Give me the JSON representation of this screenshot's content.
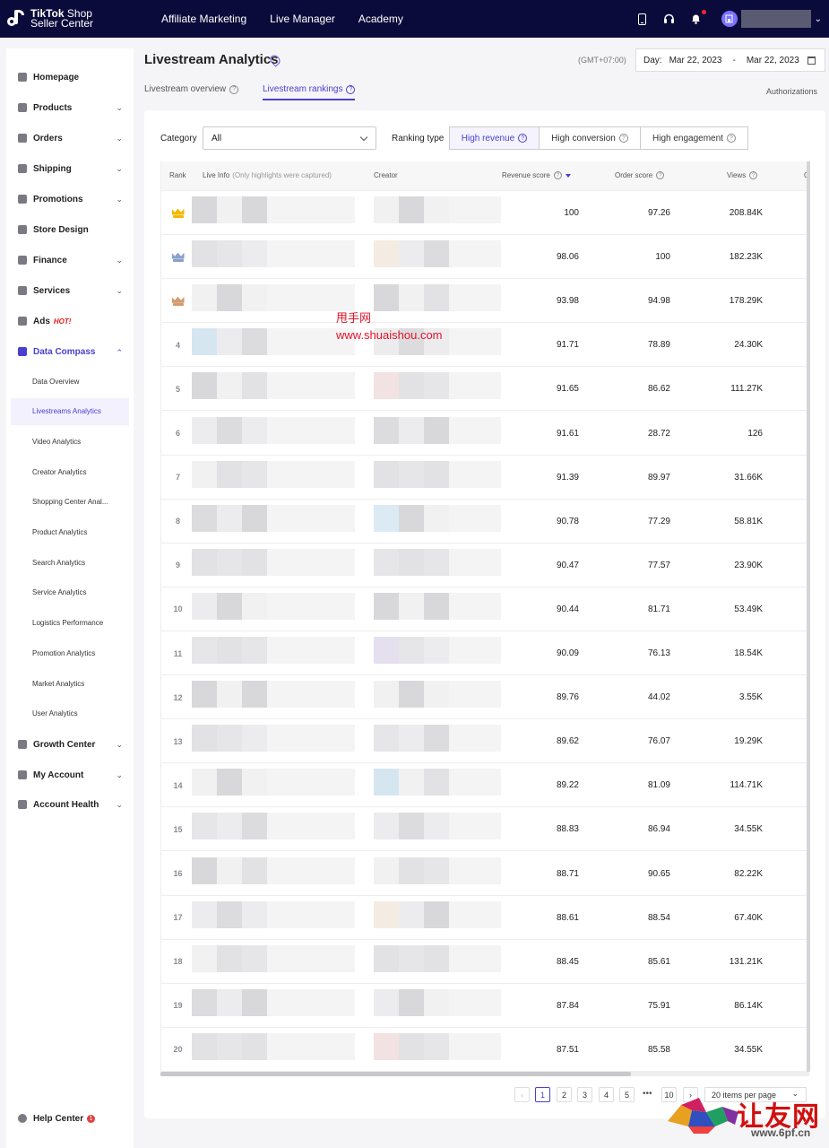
{
  "topbar": {
    "logo_line1": "TikTok",
    "logo_line1b": " Shop",
    "logo_line2": "Seller Center",
    "nav": [
      "Affiliate Marketing",
      "Live Manager",
      "Academy"
    ],
    "avatar_letter": "D"
  },
  "sidebar": {
    "items": [
      {
        "label": "Homepage",
        "icon": "home-icon",
        "caret": false
      },
      {
        "label": "Products",
        "icon": "box-icon",
        "caret": true
      },
      {
        "label": "Orders",
        "icon": "orders-icon",
        "caret": true
      },
      {
        "label": "Shipping",
        "icon": "truck-icon",
        "caret": true
      },
      {
        "label": "Promotions",
        "icon": "megaphone-icon",
        "caret": true
      },
      {
        "label": "Store Design",
        "icon": "store-icon",
        "caret": false
      },
      {
        "label": "Finance",
        "icon": "card-icon",
        "caret": true
      },
      {
        "label": "Services",
        "icon": "globe-icon",
        "caret": true
      },
      {
        "label": "Ads",
        "icon": "ads-icon",
        "caret": false,
        "badge": "HOT!"
      },
      {
        "label": "Data Compass",
        "icon": "chart-icon",
        "caret": true,
        "expanded": true
      }
    ],
    "sub_items": [
      "Data Overview",
      "Livestreams Analytics",
      "Video Analytics",
      "Creator Analytics",
      "Shopping Center Anal...",
      "Product Analytics",
      "Search Analytics",
      "Service Analytics",
      "Logistics Performance",
      "Promotion Analytics",
      "Market Analytics",
      "User Analytics"
    ],
    "active_sub": 1,
    "bottom_items": [
      {
        "label": "Growth Center",
        "icon": "growth-icon"
      },
      {
        "label": "My Account",
        "icon": "user-icon"
      },
      {
        "label": "Account Health",
        "icon": "shield-icon"
      }
    ],
    "help": {
      "label": "Help Center",
      "badge": "1"
    }
  },
  "header": {
    "title": "Livestream Analytics",
    "timezone": "(GMT+07:00)",
    "date_prefix": "Day:",
    "date_start": "Mar 22, 2023",
    "date_sep": "-",
    "date_end": "Mar 22, 2023",
    "tabs": [
      "Livestream overview",
      "Livestream rankings"
    ],
    "active_tab": 1,
    "authorizations": "Authorizations"
  },
  "filters": {
    "category_label": "Category",
    "category_value": "All",
    "ranking_label": "Ranking type",
    "ranking_options": [
      "High revenue",
      "High conversion",
      "High engagement"
    ],
    "active_ranking": 0
  },
  "table": {
    "headers": {
      "rank": "Rank",
      "live_info": "Live Info",
      "live_info_note": "(Only highlights were captured)",
      "creator": "Creator",
      "revenue": "Revenue score",
      "order": "Order score",
      "views": "Views",
      "cut": "C"
    },
    "rows": [
      {
        "rank": "1",
        "revenue": "100",
        "order": "97.26",
        "views": "208.84K"
      },
      {
        "rank": "2",
        "revenue": "98.06",
        "order": "100",
        "views": "182.23K"
      },
      {
        "rank": "3",
        "revenue": "93.98",
        "order": "94.98",
        "views": "178.29K"
      },
      {
        "rank": "4",
        "revenue": "91.71",
        "order": "78.89",
        "views": "24.30K"
      },
      {
        "rank": "5",
        "revenue": "91.65",
        "order": "86.62",
        "views": "111.27K"
      },
      {
        "rank": "6",
        "revenue": "91.61",
        "order": "28.72",
        "views": "126"
      },
      {
        "rank": "7",
        "revenue": "91.39",
        "order": "89.97",
        "views": "31.66K"
      },
      {
        "rank": "8",
        "revenue": "90.78",
        "order": "77.29",
        "views": "58.81K"
      },
      {
        "rank": "9",
        "revenue": "90.47",
        "order": "77.57",
        "views": "23.90K"
      },
      {
        "rank": "10",
        "revenue": "90.44",
        "order": "81.71",
        "views": "53.49K"
      },
      {
        "rank": "11",
        "revenue": "90.09",
        "order": "76.13",
        "views": "18.54K"
      },
      {
        "rank": "12",
        "revenue": "89.76",
        "order": "44.02",
        "views": "3.55K"
      },
      {
        "rank": "13",
        "revenue": "89.62",
        "order": "76.07",
        "views": "19.29K"
      },
      {
        "rank": "14",
        "revenue": "89.22",
        "order": "81.09",
        "views": "114.71K"
      },
      {
        "rank": "15",
        "revenue": "88.83",
        "order": "86.94",
        "views": "34.55K"
      },
      {
        "rank": "16",
        "revenue": "88.71",
        "order": "90.65",
        "views": "82.22K"
      },
      {
        "rank": "17",
        "revenue": "88.61",
        "order": "88.54",
        "views": "67.40K"
      },
      {
        "rank": "18",
        "revenue": "88.45",
        "order": "85.61",
        "views": "131.21K"
      },
      {
        "rank": "19",
        "revenue": "87.84",
        "order": "75.91",
        "views": "86.14K"
      },
      {
        "rank": "20",
        "revenue": "87.51",
        "order": "85.58",
        "views": "34.55K"
      }
    ],
    "crown_colors": [
      "#f5b800",
      "#8aa0c8",
      "#d49a6a"
    ]
  },
  "pagination": {
    "pages": [
      "1",
      "2",
      "3",
      "4",
      "5"
    ],
    "ellipsis": "•••",
    "last": "10",
    "active": "1",
    "per_page": "20 items per page"
  },
  "watermarks": {
    "cn": "甩手网",
    "url": "www.shuaishou.com",
    "cn2": "让友网",
    "url2": "www.6pf.cn"
  }
}
